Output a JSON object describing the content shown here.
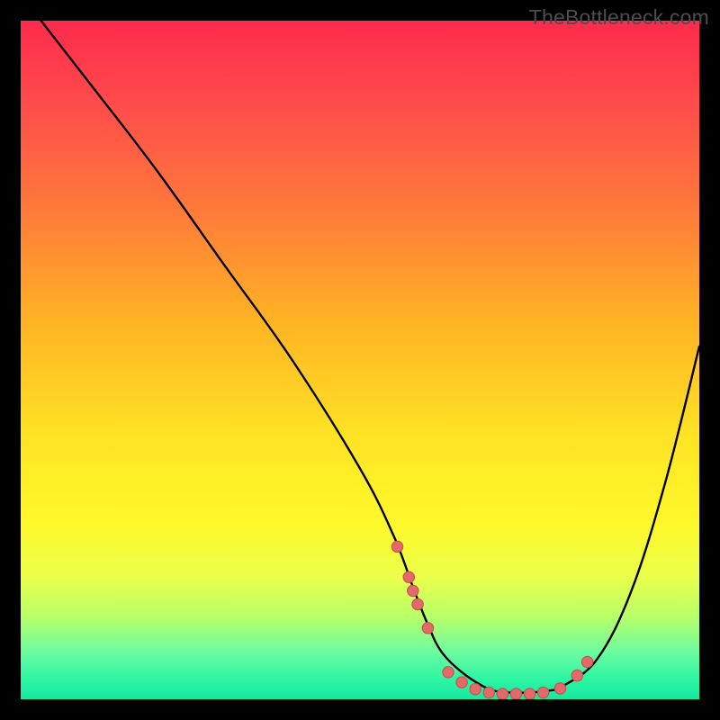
{
  "watermark": "TheBottleneck.com",
  "colors": {
    "bg": "#000000",
    "curve": "#000000",
    "dot_fill": "#e46a6a",
    "dot_stroke": "#c94f4f",
    "gradient_top": "#ff2a4d",
    "gradient_bottom": "#14e9a0"
  },
  "chart_data": {
    "type": "line",
    "title": "",
    "xlabel": "",
    "ylabel": "",
    "xlim": [
      0,
      100
    ],
    "ylim": [
      0,
      100
    ],
    "grid": false,
    "legend": false,
    "series": [
      {
        "name": "curve",
        "x": [
          3,
          10,
          20,
          30,
          40,
          50,
          55,
          58,
          60,
          62,
          65,
          68,
          70,
          72,
          75,
          78,
          80,
          85,
          90,
          95,
          100
        ],
        "values": [
          100,
          91,
          78,
          64,
          50,
          34,
          24,
          16,
          11,
          7,
          4,
          2,
          1.2,
          1,
          1,
          1.3,
          2,
          6,
          16,
          32,
          52
        ]
      }
    ],
    "scatter_points": {
      "name": "markers",
      "x": [
        55.5,
        57.2,
        57.8,
        58.5,
        60.0,
        63.0,
        65.0,
        67.0,
        69.0,
        71.0,
        73.0,
        75.0,
        77.0,
        79.5,
        82.0,
        83.5
      ],
      "values": [
        22.5,
        18.0,
        16.0,
        14.0,
        10.5,
        4.0,
        2.5,
        1.5,
        1.0,
        0.8,
        0.8,
        0.8,
        1.0,
        1.6,
        3.5,
        5.5
      ]
    }
  }
}
